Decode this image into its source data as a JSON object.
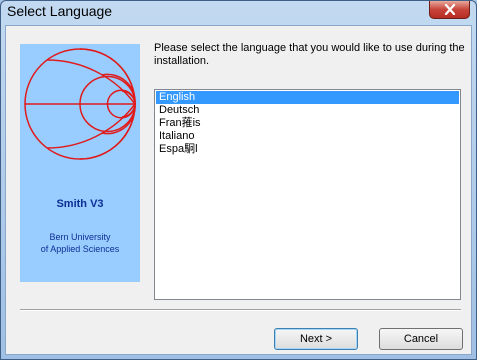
{
  "window": {
    "title": "Select Language"
  },
  "banner": {
    "product_name": "Smith V3",
    "org_line1": "Bern University",
    "org_line2": "of Applied Sciences"
  },
  "prompt": "Please select the language that you would like to use during the installation.",
  "languages": {
    "items": [
      "English",
      "Deutsch",
      "Fran蓷is",
      "Italiano",
      "Espa駉l"
    ],
    "selected": "English"
  },
  "buttons": {
    "next": "Next >",
    "cancel": "Cancel"
  },
  "colors": {
    "banner_bg": "#99ccff",
    "chart_red": "#e01b1b",
    "selection": "#3399ff"
  }
}
